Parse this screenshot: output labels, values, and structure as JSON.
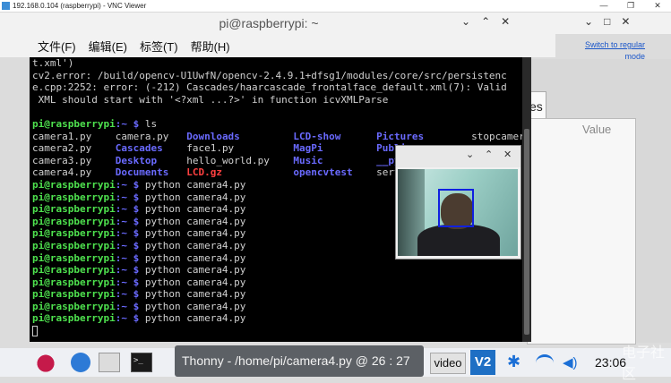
{
  "vnc": {
    "title": "192.168.0.104 (raspberrypi) - VNC Viewer",
    "controls": [
      "—",
      "❐",
      "✕"
    ]
  },
  "window": {
    "title": "pi@raspberrypi: ~",
    "ctrl_a": [
      "⌄",
      "⌃",
      "✕"
    ],
    "ctrl_b": [
      "⌄",
      "□",
      "✕"
    ]
  },
  "menu": [
    "文件(F)",
    "编辑(E)",
    "标签(T)",
    "帮助(H)"
  ],
  "scale_link": "Switch to regular mode",
  "bg_panel": {
    "tab_fragment": "es",
    "value_header": "Value"
  },
  "terminal": {
    "error_lines": [
      "t.xml')",
      "cv2.error: /build/opencv-U1UwfN/opencv-2.4.9.1+dfsg1/modules/core/src/persistenc",
      "e.cpp:2252: error: (-212) Cascades/haarcascade_frontalface_default.xml(7): Valid",
      " XML should start with '<?xml ...?>' in function icvXMLParse"
    ],
    "prompt_user": "pi@raspberrypi",
    "prompt_path": ":~ $ ",
    "ls_command": "ls",
    "ls_rows": [
      [
        "camera1.py",
        "camera.py",
        "Downloads",
        "LCD-show",
        "Pictures",
        "stopcamera.py"
      ],
      [
        "camera2.py",
        "Cascades",
        "face1.py",
        "MagPi",
        "Public",
        ""
      ],
      [
        "camera3.py",
        "Desktop",
        "hello_world.py",
        "Music",
        "__pycache__",
        ""
      ],
      [
        "camera4.py",
        "Documents",
        "LCD.gz",
        "opencvtest",
        "servoCtrl",
        ""
      ]
    ],
    "run_command": "python camera4.py",
    "run_count": 12
  },
  "camera_window": {
    "controls": [
      "⌄",
      "⌃",
      "✕"
    ]
  },
  "taskbar": {
    "term_glyph": ">_",
    "thonny_tip": "Thonny  -  /home/pi/camera4.py  @  26 : 27",
    "video_label": "video",
    "vnc_label": "V2",
    "clock": "23:06"
  },
  "watermark": "电子社区",
  "colors": {
    "terminal_bg": "#000000",
    "prompt_green": "#4ee14e",
    "dir_blue": "#6a6aff",
    "gz_red": "#ff4040"
  }
}
